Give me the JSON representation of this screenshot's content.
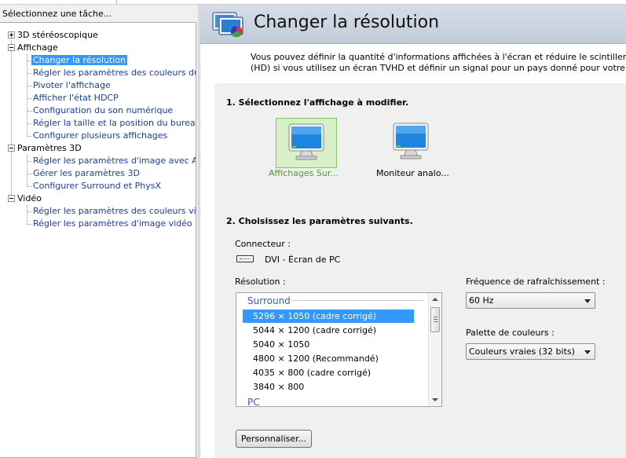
{
  "left_panel": {
    "header": "Sélectionnez une tâche...",
    "tree": [
      {
        "type": "cat",
        "label": "3D stéréoscopique",
        "expanded": false
      },
      {
        "type": "cat",
        "label": "Affichage",
        "expanded": true
      },
      {
        "type": "leaf",
        "label": "Changer la résolution",
        "selected": true
      },
      {
        "type": "leaf",
        "label": "Régler les paramètres des couleurs du bure"
      },
      {
        "type": "leaf",
        "label": "Pivoter l'affichage"
      },
      {
        "type": "leaf",
        "label": "Afficher l'état HDCP"
      },
      {
        "type": "leaf",
        "label": "Configuration du son numérique"
      },
      {
        "type": "leaf",
        "label": "Régler la taille et la position du bureau"
      },
      {
        "type": "leaf",
        "label": "Configurer plusieurs affichages"
      },
      {
        "type": "cat",
        "label": "Paramètres 3D",
        "expanded": true
      },
      {
        "type": "leaf",
        "label": "Régler les paramètres d'image avec Aperçu"
      },
      {
        "type": "leaf",
        "label": "Gérer les paramètres 3D"
      },
      {
        "type": "leaf",
        "label": "Configurer Surround et PhysX"
      },
      {
        "type": "cat",
        "label": "Vidéo",
        "expanded": true
      },
      {
        "type": "leaf",
        "label": "Régler les paramètres des couleurs vidéo"
      },
      {
        "type": "leaf",
        "label": "Régler les paramètres d'image vidéo"
      }
    ]
  },
  "main": {
    "title": "Changer la résolution",
    "intro_line1": "Vous pouvez définir la quantité d'informations affichées à l'écran et réduire le scintillement. Vous pou",
    "intro_line2": "(HD) si vous utilisez un écran TVHD et définir un signal pour un pays donné pour votre téléviseur de",
    "section1": "1. Sélectionnez l'affichage à modifier.",
    "displays": [
      {
        "label": "Affichages Sur...",
        "selected": true
      },
      {
        "label": "Moniteur analo...",
        "selected": false
      }
    ],
    "section2": "2. Choisissez les paramètres suivants.",
    "connector_label": "Connecteur :",
    "connector_value": "DVI - Écran de PC",
    "resolution_label": "Résolution :",
    "resolution_group": "Surround",
    "resolution_group2": "PC",
    "resolutions": [
      {
        "label": "5296 × 1050 (cadre corrigé)",
        "selected": true
      },
      {
        "label": "5044 × 1200 (cadre corrigé)"
      },
      {
        "label": "5040 × 1050"
      },
      {
        "label": "4800 × 1200 (Recommandé)"
      },
      {
        "label": "4035 × 800 (cadre corrigé)"
      },
      {
        "label": "3840 × 800"
      }
    ],
    "refresh_label": "Fréquence de rafraîchissement :",
    "refresh_value": "60 Hz",
    "palette_label": "Palette de couleurs :",
    "palette_value": "Couleurs vraies (32 bits)",
    "customize_button": "Personnaliser..."
  },
  "colors": {
    "selection": "#3399ff",
    "selected_tile": "#d7f1c7",
    "selected_tile_text": "#4aa122",
    "tree_link": "#1b3f9f"
  }
}
